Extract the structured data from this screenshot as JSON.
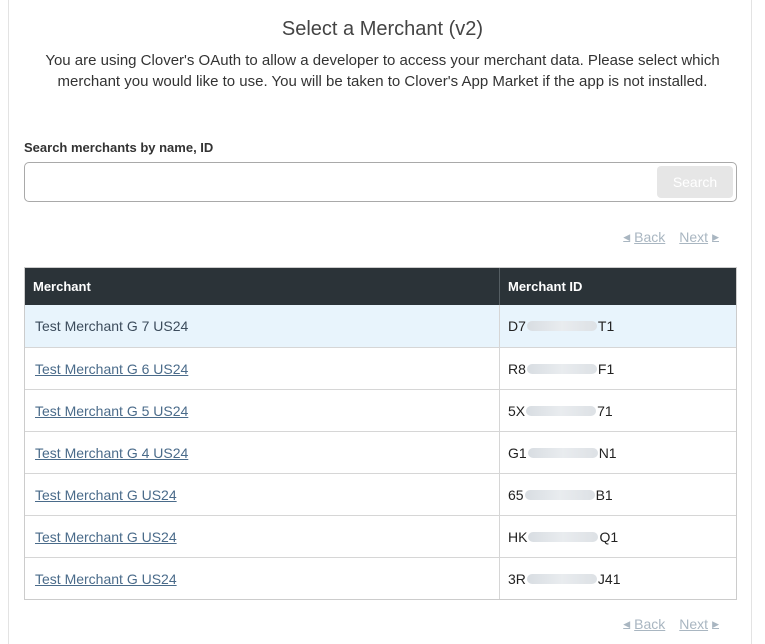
{
  "header": {
    "title": "Select a Merchant (v2)",
    "description": "You are using Clover's OAuth to allow a developer to access your merchant data. Please select which merchant you would like to use. You will be taken to Clover's App Market if the app is not installed."
  },
  "search": {
    "label": "Search merchants by name, ID",
    "value": "",
    "placeholder": "",
    "button_label": "Search"
  },
  "pager": {
    "back_label": "Back",
    "next_label": "Next",
    "back_icon": "triangle-left-icon",
    "next_icon": "triangle-right-icon"
  },
  "table": {
    "columns": [
      "Merchant",
      "Merchant ID"
    ],
    "rows": [
      {
        "name": "Test Merchant G 7 US24",
        "id_prefix": "D7",
        "id_suffix": "T1",
        "selected": true
      },
      {
        "name": "Test Merchant G 6 US24",
        "id_prefix": "R8",
        "id_suffix": "F1",
        "selected": false
      },
      {
        "name": "Test Merchant G  5 US24",
        "id_prefix": "5X",
        "id_suffix": "71",
        "selected": false
      },
      {
        "name": "Test Merchant G  4 US24",
        "id_prefix": "G1",
        "id_suffix": "N1",
        "selected": false
      },
      {
        "name": "Test Merchant G  US24",
        "id_prefix": "65",
        "id_suffix": "B1",
        "selected": false
      },
      {
        "name": "Test Merchant G  US24",
        "id_prefix": "HK",
        "id_suffix": "Q1",
        "selected": false
      },
      {
        "name": "Test Merchant G  US24",
        "id_prefix": "3R",
        "id_suffix": "J41",
        "selected": false
      }
    ]
  },
  "colors": {
    "header_bg": "#2b3338",
    "selected_row_bg": "#e8f4fc",
    "link": "#4a6b8a",
    "pager_disabled": "#a9b6c1"
  }
}
